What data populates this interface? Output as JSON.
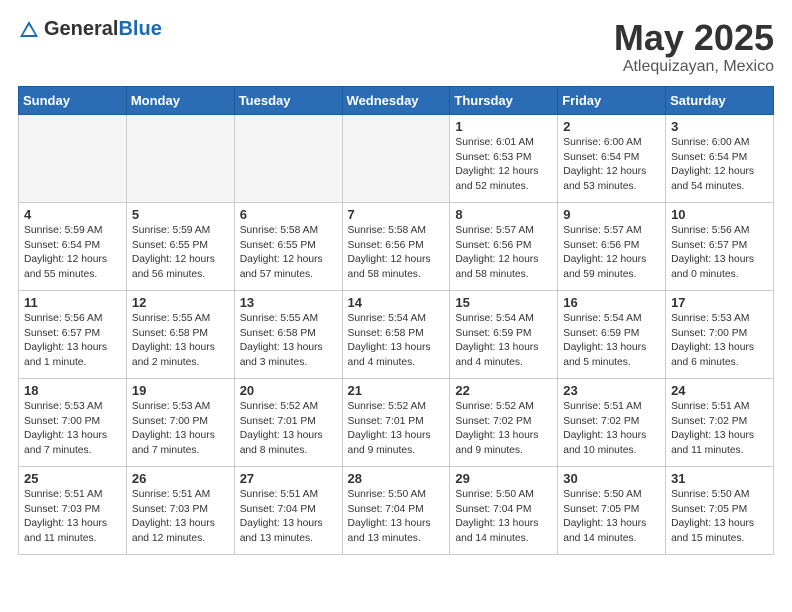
{
  "header": {
    "logo_general": "General",
    "logo_blue": "Blue",
    "month": "May 2025",
    "location": "Atlequizayan, Mexico"
  },
  "weekdays": [
    "Sunday",
    "Monday",
    "Tuesday",
    "Wednesday",
    "Thursday",
    "Friday",
    "Saturday"
  ],
  "weeks": [
    [
      {
        "day": "",
        "info": ""
      },
      {
        "day": "",
        "info": ""
      },
      {
        "day": "",
        "info": ""
      },
      {
        "day": "",
        "info": ""
      },
      {
        "day": "1",
        "info": "Sunrise: 6:01 AM\nSunset: 6:53 PM\nDaylight: 12 hours\nand 52 minutes."
      },
      {
        "day": "2",
        "info": "Sunrise: 6:00 AM\nSunset: 6:54 PM\nDaylight: 12 hours\nand 53 minutes."
      },
      {
        "day": "3",
        "info": "Sunrise: 6:00 AM\nSunset: 6:54 PM\nDaylight: 12 hours\nand 54 minutes."
      }
    ],
    [
      {
        "day": "4",
        "info": "Sunrise: 5:59 AM\nSunset: 6:54 PM\nDaylight: 12 hours\nand 55 minutes."
      },
      {
        "day": "5",
        "info": "Sunrise: 5:59 AM\nSunset: 6:55 PM\nDaylight: 12 hours\nand 56 minutes."
      },
      {
        "day": "6",
        "info": "Sunrise: 5:58 AM\nSunset: 6:55 PM\nDaylight: 12 hours\nand 57 minutes."
      },
      {
        "day": "7",
        "info": "Sunrise: 5:58 AM\nSunset: 6:56 PM\nDaylight: 12 hours\nand 58 minutes."
      },
      {
        "day": "8",
        "info": "Sunrise: 5:57 AM\nSunset: 6:56 PM\nDaylight: 12 hours\nand 58 minutes."
      },
      {
        "day": "9",
        "info": "Sunrise: 5:57 AM\nSunset: 6:56 PM\nDaylight: 12 hours\nand 59 minutes."
      },
      {
        "day": "10",
        "info": "Sunrise: 5:56 AM\nSunset: 6:57 PM\nDaylight: 13 hours\nand 0 minutes."
      }
    ],
    [
      {
        "day": "11",
        "info": "Sunrise: 5:56 AM\nSunset: 6:57 PM\nDaylight: 13 hours\nand 1 minute."
      },
      {
        "day": "12",
        "info": "Sunrise: 5:55 AM\nSunset: 6:58 PM\nDaylight: 13 hours\nand 2 minutes."
      },
      {
        "day": "13",
        "info": "Sunrise: 5:55 AM\nSunset: 6:58 PM\nDaylight: 13 hours\nand 3 minutes."
      },
      {
        "day": "14",
        "info": "Sunrise: 5:54 AM\nSunset: 6:58 PM\nDaylight: 13 hours\nand 4 minutes."
      },
      {
        "day": "15",
        "info": "Sunrise: 5:54 AM\nSunset: 6:59 PM\nDaylight: 13 hours\nand 4 minutes."
      },
      {
        "day": "16",
        "info": "Sunrise: 5:54 AM\nSunset: 6:59 PM\nDaylight: 13 hours\nand 5 minutes."
      },
      {
        "day": "17",
        "info": "Sunrise: 5:53 AM\nSunset: 7:00 PM\nDaylight: 13 hours\nand 6 minutes."
      }
    ],
    [
      {
        "day": "18",
        "info": "Sunrise: 5:53 AM\nSunset: 7:00 PM\nDaylight: 13 hours\nand 7 minutes."
      },
      {
        "day": "19",
        "info": "Sunrise: 5:53 AM\nSunset: 7:00 PM\nDaylight: 13 hours\nand 7 minutes."
      },
      {
        "day": "20",
        "info": "Sunrise: 5:52 AM\nSunset: 7:01 PM\nDaylight: 13 hours\nand 8 minutes."
      },
      {
        "day": "21",
        "info": "Sunrise: 5:52 AM\nSunset: 7:01 PM\nDaylight: 13 hours\nand 9 minutes."
      },
      {
        "day": "22",
        "info": "Sunrise: 5:52 AM\nSunset: 7:02 PM\nDaylight: 13 hours\nand 9 minutes."
      },
      {
        "day": "23",
        "info": "Sunrise: 5:51 AM\nSunset: 7:02 PM\nDaylight: 13 hours\nand 10 minutes."
      },
      {
        "day": "24",
        "info": "Sunrise: 5:51 AM\nSunset: 7:02 PM\nDaylight: 13 hours\nand 11 minutes."
      }
    ],
    [
      {
        "day": "25",
        "info": "Sunrise: 5:51 AM\nSunset: 7:03 PM\nDaylight: 13 hours\nand 11 minutes."
      },
      {
        "day": "26",
        "info": "Sunrise: 5:51 AM\nSunset: 7:03 PM\nDaylight: 13 hours\nand 12 minutes."
      },
      {
        "day": "27",
        "info": "Sunrise: 5:51 AM\nSunset: 7:04 PM\nDaylight: 13 hours\nand 13 minutes."
      },
      {
        "day": "28",
        "info": "Sunrise: 5:50 AM\nSunset: 7:04 PM\nDaylight: 13 hours\nand 13 minutes."
      },
      {
        "day": "29",
        "info": "Sunrise: 5:50 AM\nSunset: 7:04 PM\nDaylight: 13 hours\nand 14 minutes."
      },
      {
        "day": "30",
        "info": "Sunrise: 5:50 AM\nSunset: 7:05 PM\nDaylight: 13 hours\nand 14 minutes."
      },
      {
        "day": "31",
        "info": "Sunrise: 5:50 AM\nSunset: 7:05 PM\nDaylight: 13 hours\nand 15 minutes."
      }
    ]
  ]
}
